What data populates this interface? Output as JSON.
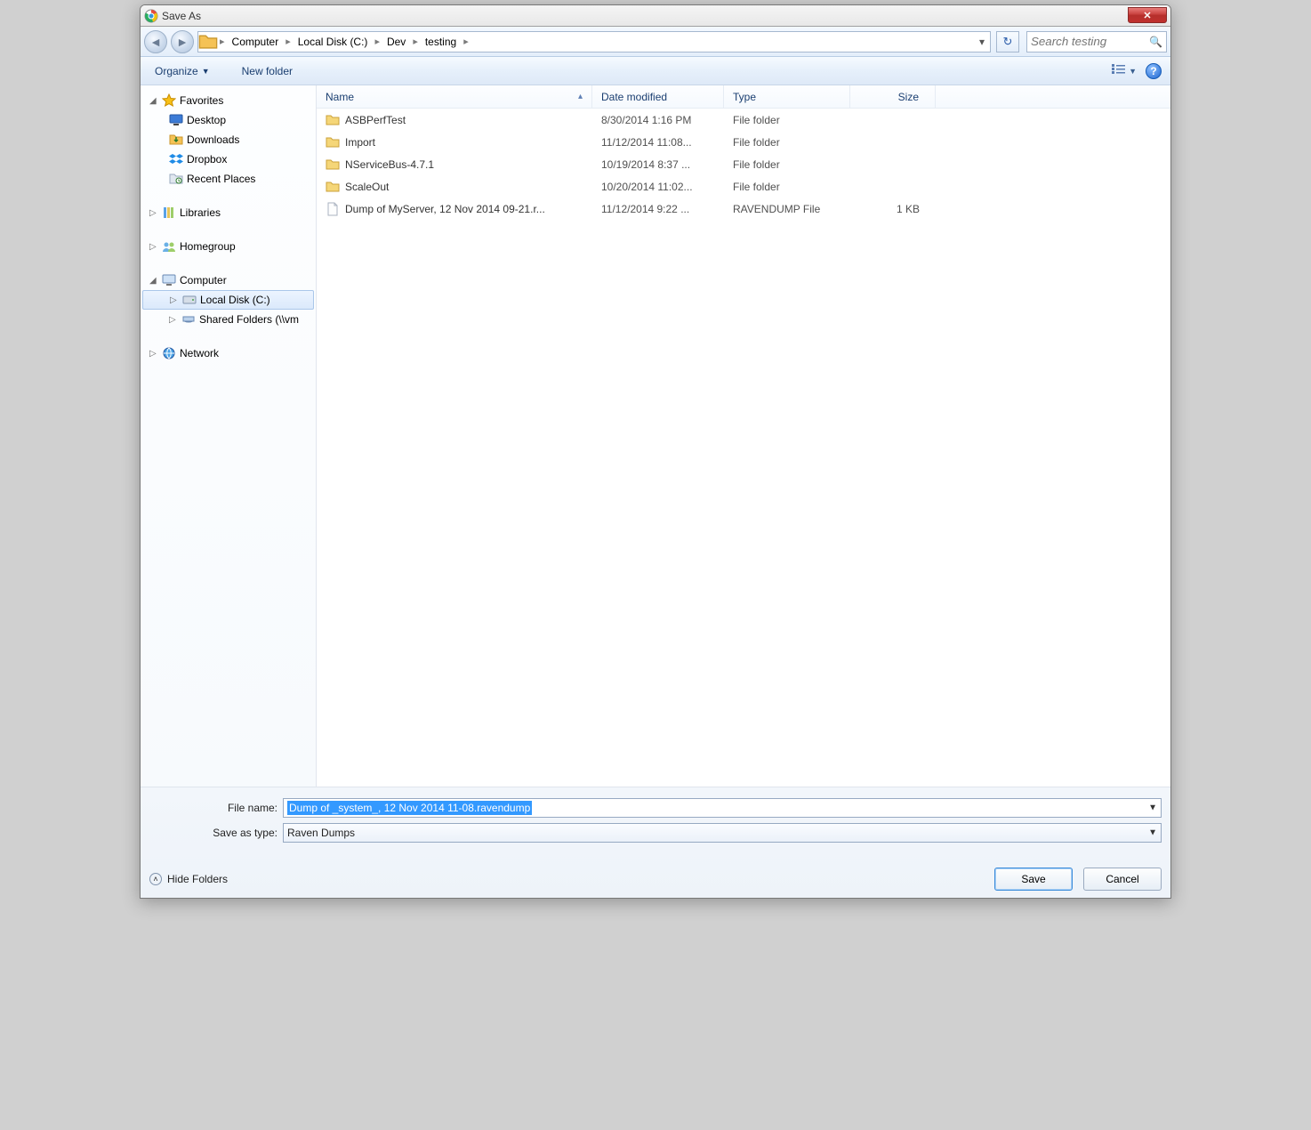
{
  "title": "Save As",
  "close_glyph": "✕",
  "breadcrumb": [
    "Computer",
    "Local Disk (C:)",
    "Dev",
    "testing"
  ],
  "search_placeholder": "Search testing",
  "toolbar": {
    "organize": "Organize",
    "newfolder": "New folder"
  },
  "tree": {
    "favorites": "Favorites",
    "desktop": "Desktop",
    "downloads": "Downloads",
    "dropbox": "Dropbox",
    "recent": "Recent Places",
    "libraries": "Libraries",
    "homegroup": "Homegroup",
    "computer": "Computer",
    "local_disk": "Local Disk (C:)",
    "shared": "Shared Folders (\\\\vm",
    "network": "Network"
  },
  "columns": {
    "name": "Name",
    "date": "Date modified",
    "type": "Type",
    "size": "Size"
  },
  "files": [
    {
      "name": "ASBPerfTest",
      "date": "8/30/2014 1:16 PM",
      "type": "File folder",
      "size": "",
      "icon": "folder"
    },
    {
      "name": "Import",
      "date": "11/12/2014 11:08...",
      "type": "File folder",
      "size": "",
      "icon": "folder"
    },
    {
      "name": "NServiceBus-4.7.1",
      "date": "10/19/2014 8:37 ...",
      "type": "File folder",
      "size": "",
      "icon": "folder"
    },
    {
      "name": "ScaleOut",
      "date": "10/20/2014 11:02...",
      "type": "File folder",
      "size": "",
      "icon": "folder"
    },
    {
      "name": "Dump of MyServer, 12 Nov 2014 09-21.r...",
      "date": "11/12/2014 9:22 ...",
      "type": "RAVENDUMP File",
      "size": "1 KB",
      "icon": "file"
    }
  ],
  "labels": {
    "filename": "File name:",
    "savetype": "Save as type:",
    "hide_folders": "Hide Folders",
    "save": "Save",
    "cancel": "Cancel"
  },
  "filename_value": "Dump of _system_, 12 Nov 2014 11-08.ravendump",
  "savetype_value": "Raven Dumps"
}
